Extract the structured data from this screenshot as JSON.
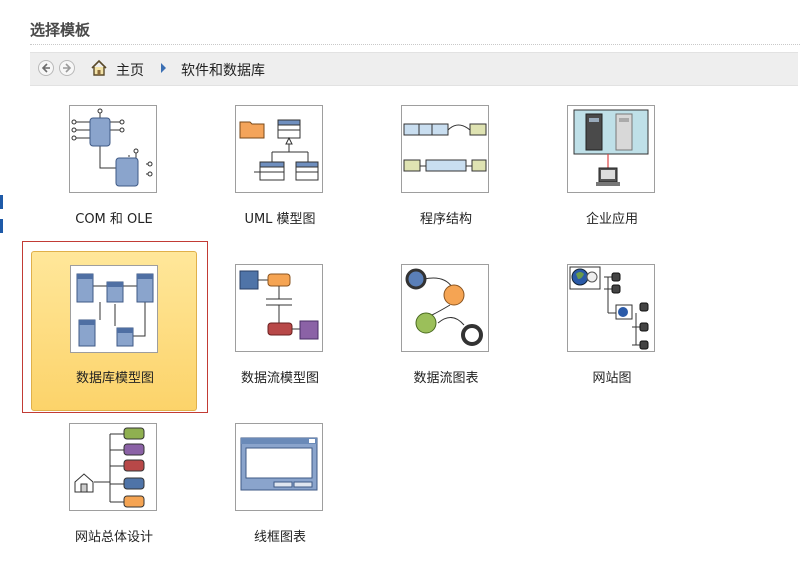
{
  "header": {
    "title": "选择模板"
  },
  "breadcrumb": {
    "back_icon": "back-arrow-icon",
    "forward_icon": "forward-arrow-icon",
    "home_icon": "home-icon",
    "home_label": "主页",
    "current_label": "软件和数据库"
  },
  "colors": {
    "selection_fill": "#fcd36a",
    "selection_border": "#c23b35",
    "nav_bg": "#eeeeee"
  },
  "templates": [
    {
      "label": "COM 和 OLE",
      "icon": "com-ole-icon",
      "selected": false
    },
    {
      "label": "UML 模型图",
      "icon": "uml-diagram-icon",
      "selected": false
    },
    {
      "label": "程序结构",
      "icon": "program-structure-icon",
      "selected": false
    },
    {
      "label": "企业应用",
      "icon": "enterprise-app-icon",
      "selected": false
    },
    {
      "label": "数据库模型图",
      "icon": "database-model-icon",
      "selected": true
    },
    {
      "label": "数据流模型图",
      "icon": "data-flow-model-icon",
      "selected": false
    },
    {
      "label": "数据流图表",
      "icon": "data-flow-chart-icon",
      "selected": false
    },
    {
      "label": "网站图",
      "icon": "website-map-icon",
      "selected": false
    },
    {
      "label": "网站总体设计",
      "icon": "website-design-icon",
      "selected": false
    },
    {
      "label": "线框图表",
      "icon": "wireframe-icon",
      "selected": false
    }
  ]
}
